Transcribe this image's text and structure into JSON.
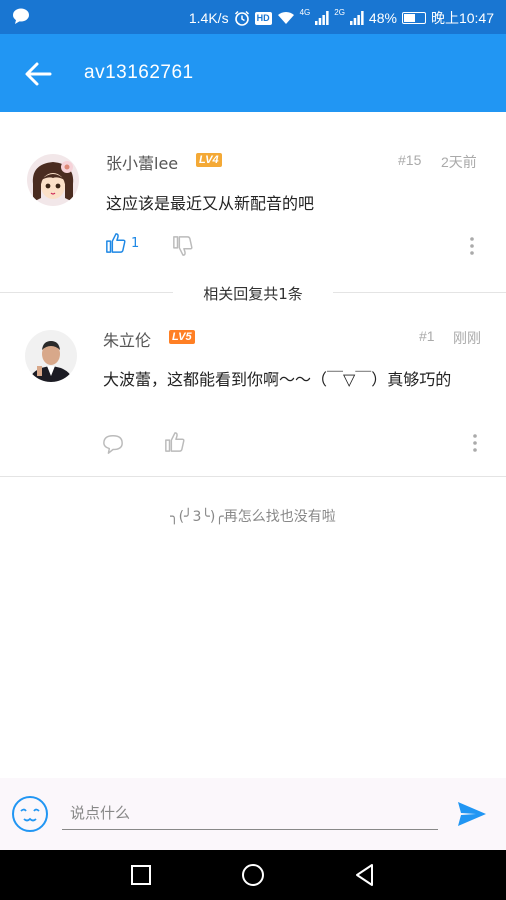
{
  "status_bar": {
    "speed": "1.4K/s",
    "hd": "HD",
    "net1": "4G",
    "net2": "2G",
    "battery": "48%",
    "battery_level": 0.48,
    "time": "晚上10:47"
  },
  "app_bar": {
    "title": "av13162761"
  },
  "main_comment": {
    "user": "张小蕾lee",
    "level": "LV4",
    "level_color": "#f4a936",
    "floor": "#15",
    "time": "2天前",
    "text": "这应该是最近又从新配音的吧",
    "like_count": "1"
  },
  "section_title": "相关回复共1条",
  "reply": {
    "user": "朱立伦",
    "level": "LV5",
    "level_color": "#ff7f24",
    "floor": "#1",
    "time": "刚刚",
    "text": "大波蕾，这都能看到你啊～～（￣▽￣）真够巧的"
  },
  "empty_note": "╮(╯3╰)╭再怎么找也没有啦",
  "input": {
    "placeholder": "说点什么"
  },
  "colors": {
    "status_bar": "#1976d2",
    "app_bar": "#2196f3",
    "accent": "#1e88e5"
  }
}
